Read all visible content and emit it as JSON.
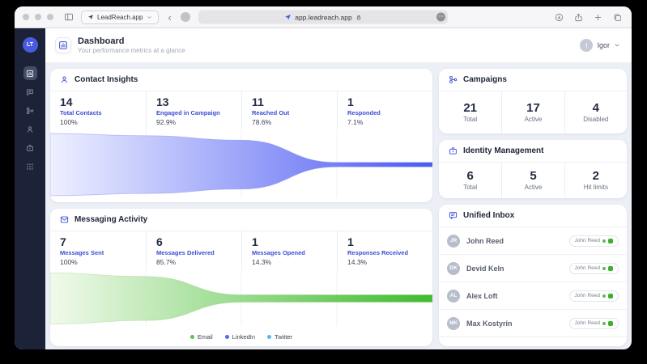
{
  "browser": {
    "tab_label": "LeadReach.app",
    "url": "app.leadreach.app"
  },
  "icons": {
    "back_glyph": "‹",
    "more_glyph": "⋯"
  },
  "sidebar": {
    "avatar_initials": "LT",
    "items": [
      {
        "id": "dashboard",
        "active": true
      },
      {
        "id": "messages",
        "active": false
      },
      {
        "id": "campaigns",
        "active": false
      },
      {
        "id": "contacts",
        "active": false
      },
      {
        "id": "identity",
        "active": false
      },
      {
        "id": "apps",
        "active": false
      }
    ]
  },
  "header": {
    "title": "Dashboard",
    "subtitle": "Your performance metrics at a glance",
    "user_initial": "I",
    "user_name": "Igor"
  },
  "contact_insights": {
    "title": "Contact Insights",
    "stats": [
      {
        "value": "14",
        "label": "Total Contacts",
        "pct": "100%"
      },
      {
        "value": "13",
        "label": "Engaged in Campaign",
        "pct": "92.9%"
      },
      {
        "value": "11",
        "label": "Reached Out",
        "pct": "78.6%"
      },
      {
        "value": "1",
        "label": "Responded",
        "pct": "7.1%"
      }
    ]
  },
  "campaigns": {
    "title": "Campaigns",
    "stats": [
      {
        "value": "21",
        "label": "Total"
      },
      {
        "value": "17",
        "label": "Active"
      },
      {
        "value": "4",
        "label": "Disabled"
      }
    ]
  },
  "identity": {
    "title": "Identity Management",
    "stats": [
      {
        "value": "6",
        "label": "Total"
      },
      {
        "value": "5",
        "label": "Active"
      },
      {
        "value": "2",
        "label": "Hit limits"
      }
    ]
  },
  "messaging": {
    "title": "Messaging Activity",
    "stats": [
      {
        "value": "7",
        "label": "Messages Sent",
        "pct": "100%"
      },
      {
        "value": "6",
        "label": "Messages Delivered",
        "pct": "85.7%"
      },
      {
        "value": "1",
        "label": "Messages Opened",
        "pct": "14.3%"
      },
      {
        "value": "1",
        "label": "Responses Received",
        "pct": "14.3%"
      }
    ],
    "legend": [
      {
        "label": "Email",
        "color": "#5cc24e"
      },
      {
        "label": "LinkedIn",
        "color": "#5b67ee"
      },
      {
        "label": "Twitter",
        "color": "#56b8f0"
      }
    ]
  },
  "inbox": {
    "title": "Unified Inbox",
    "members": [
      {
        "initials": "JR",
        "name": "John Reed",
        "badge": "John Reed"
      },
      {
        "initials": "DK",
        "name": "Devid Keln",
        "badge": "John Reed"
      },
      {
        "initials": "AL",
        "name": "Alex Loft",
        "badge": "John Reed"
      },
      {
        "initials": "MK",
        "name": "Max Kostyrin",
        "badge": "John Reed"
      }
    ]
  },
  "chart_data": [
    {
      "type": "area",
      "variant": "funnel",
      "title": "Contact Insights",
      "stages": [
        "Total Contacts",
        "Engaged in Campaign",
        "Reached Out",
        "Responded"
      ],
      "values": [
        14,
        13,
        11,
        1
      ],
      "percentages": [
        100,
        92.9,
        78.6,
        7.1
      ],
      "gradient": [
        "#eef0ff",
        "#4b5af2"
      ],
      "edge": "#7b86f0",
      "grid": true,
      "legend_position": "none"
    },
    {
      "type": "area",
      "variant": "funnel",
      "title": "Messaging Activity",
      "stages": [
        "Messages Sent",
        "Messages Delivered",
        "Messages Opened",
        "Responses Received"
      ],
      "values": [
        7,
        6,
        1,
        1
      ],
      "percentages": [
        100,
        85.7,
        14.3,
        14.3
      ],
      "gradient": [
        "#f1faeb",
        "#3fbb2e"
      ],
      "edge": "#8bca6f",
      "grid": true,
      "legend_position": "bottom",
      "legend": [
        "Email",
        "LinkedIn",
        "Twitter"
      ]
    }
  ]
}
